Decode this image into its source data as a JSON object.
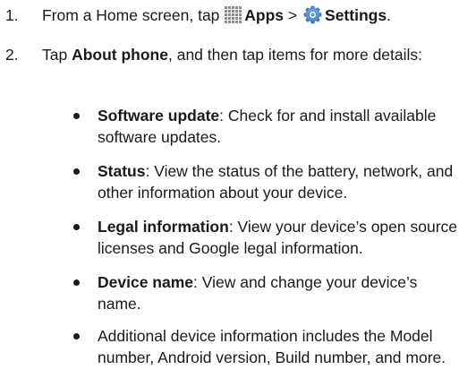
{
  "colors": {
    "text": "#1a1a1a",
    "apps_icon": "#8c8c8c",
    "settings_icon": "#3a7fd6"
  },
  "steps": [
    {
      "num": "1.",
      "prefix": "From a Home screen, tap",
      "apps_icon": "apps-grid-icon",
      "apps_label": "Apps",
      "separator": ">",
      "settings_icon": "settings-gear-icon",
      "settings_label": "Settings",
      "suffix": "."
    },
    {
      "num": "2.",
      "prefix": "Tap",
      "bold": "About phone",
      "suffix": ", and then tap items for more details:"
    }
  ],
  "bullets": [
    {
      "term": "Software update",
      "text": ": Check for and install available software updates."
    },
    {
      "term": "Status",
      "text": ": View the status of the battery, network, and other information about your device."
    },
    {
      "term": "Legal information",
      "text": ": View your device’s open source licenses and Google legal information."
    },
    {
      "term": "Device name",
      "text": ": View and change your device’s name."
    },
    {
      "term": "",
      "text": "Additional device information includes the Model number, Android version, Build number, and more."
    }
  ]
}
